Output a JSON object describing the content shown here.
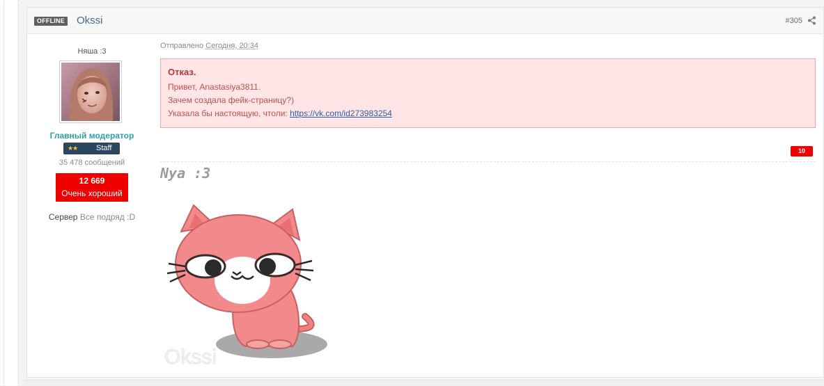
{
  "post": {
    "status": "OFFLINE",
    "author": "Okssi",
    "number": "#305",
    "meta_prefix": "Отправлено",
    "meta_date": "Сегодня, 20:34"
  },
  "author_panel": {
    "title": "Няша :3",
    "role": "Главный модератор",
    "badge_stars": "★★",
    "badge_label": "Staff",
    "messages": "35 478 сообщений",
    "rating_value": "12 669",
    "rating_label": "Очень хороший",
    "server_label": "Сервер",
    "server_value": "Все подряд :D"
  },
  "moderation": {
    "title": "Отказ.",
    "line1": "Привет, Anastasiya3811.",
    "line2": "Зачем создала фейк-страницу?)",
    "line3_prefix": "Указала бы настоящую, чтоли:",
    "link": "https://vk.com/id273983254"
  },
  "reactions": {
    "count": "10"
  },
  "signature": {
    "title": "Nya :3",
    "watermark": "Okssi"
  },
  "colors": {
    "accent": "#3f6d8d",
    "role": "#2b9ea8",
    "rating": "#ee0000",
    "mod_bg": "#ffe5e5",
    "mod_border": "#e6a8a8"
  },
  "icons": [
    "share-icon",
    "star-icon"
  ]
}
